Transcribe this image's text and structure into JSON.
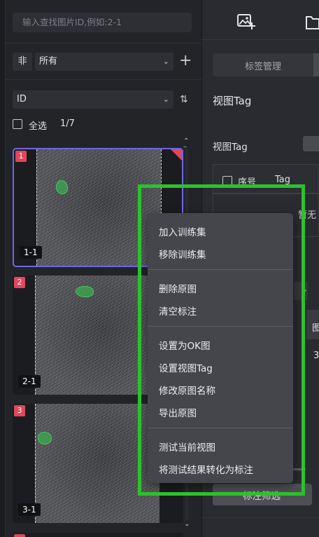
{
  "left_panel": {
    "search_placeholder": "输入查找图片ID,例如:2-1",
    "filter_not_label": "非",
    "filter_select_value": "所有",
    "sort_select_value": "ID",
    "select_all_label": "全选",
    "page_count": "1/7",
    "images": [
      {
        "index": "1",
        "name": "1-1",
        "selected": true
      },
      {
        "index": "2",
        "name": "2-1",
        "selected": false
      },
      {
        "index": "3",
        "name": "3-1",
        "selected": false
      }
    ]
  },
  "right_panel": {
    "tab_label": "标签管理",
    "section_title": "视图Tag",
    "field_label": "视图Tag",
    "table_headers": {
      "seq": "序号",
      "tag": "Tag"
    },
    "empty_text": "暂无",
    "column_partial": "图",
    "value_partial": "3",
    "button_label": "标注筛选"
  },
  "context_menu": {
    "groups": [
      [
        "加入训练集",
        "移除训练集"
      ],
      [
        "删除原图",
        "清空标注"
      ],
      [
        "设置为OK图",
        "设置视图Tag",
        "修改原图名称",
        "导出原图"
      ],
      [
        "测试当前视图",
        "将测试结果转化为标注"
      ]
    ]
  },
  "colors": {
    "accent_selected": "#6e66e4",
    "badge_red": "#e0475a",
    "highlight_green": "#2cc22c",
    "annotation_green": "#44c860"
  },
  "icons": [
    "add-image-icon",
    "folder-add-icon",
    "plus-icon",
    "sort-icon",
    "chevron-down-icon",
    "scroll-up-icon",
    "scroll-down-icon"
  ]
}
